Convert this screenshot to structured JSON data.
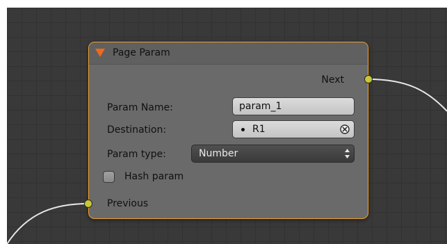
{
  "node": {
    "title": "Page Param",
    "output_socket": "Next",
    "input_socket": "Previous",
    "accent_color": "#f0a030",
    "socket_color": "#c8c832",
    "fields": {
      "param_name": {
        "label": "Param Name:",
        "value": "param_1"
      },
      "destination": {
        "label": "Destination:",
        "value": "R1",
        "icon": "dot-icon",
        "clear_icon": "clear-icon"
      },
      "param_type": {
        "label": "Param type:",
        "selected": "Number",
        "icon": "up-down-arrows-icon"
      },
      "hash_param": {
        "label": "Hash param",
        "checked": false
      }
    }
  }
}
